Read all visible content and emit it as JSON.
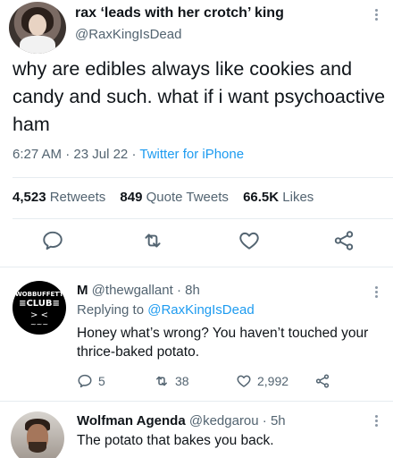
{
  "main_tweet": {
    "author_name": "rax ‘leads with her crotch’ king",
    "author_handle": "@RaxKingIsDead",
    "text": "why are edibles always like cookies and candy and such. what if i want psychoactive ham",
    "time": "6:27 AM",
    "date": "23 Jul 22",
    "source": "Twitter for iPhone",
    "stats": {
      "retweets_count": "4,523",
      "retweets_label": "Retweets",
      "quote_count": "849",
      "quote_label": "Quote Tweets",
      "likes_count": "66.5K",
      "likes_label": "Likes"
    },
    "icons": [
      "reply-icon",
      "retweet-icon",
      "like-icon",
      "share-icon"
    ]
  },
  "reply1": {
    "avatar_text": [
      "WOBBUFFETT",
      "≡CLUB≡",
      "> <",
      "~~~"
    ],
    "author_name": "M",
    "author_handle": "@thewgallant",
    "sep": "·",
    "age": "8h",
    "replying_prefix": "Replying to",
    "replying_to": "@RaxKingIsDead",
    "text": "Honey what’s wrong? You haven’t touched your thrice-baked potato.",
    "reply_count": "5",
    "retweet_count": "38",
    "like_count": "2,992"
  },
  "reply2": {
    "author_name": "Wolfman Agenda",
    "author_handle": "@kedgarou",
    "sep": "·",
    "age": "5h",
    "text": "The potato that bakes you back."
  },
  "colors": {
    "text": "#0f1419",
    "secondary": "#536471",
    "link": "#1d9bf0",
    "divider": "#e6ecf0",
    "icon": "#536471"
  }
}
